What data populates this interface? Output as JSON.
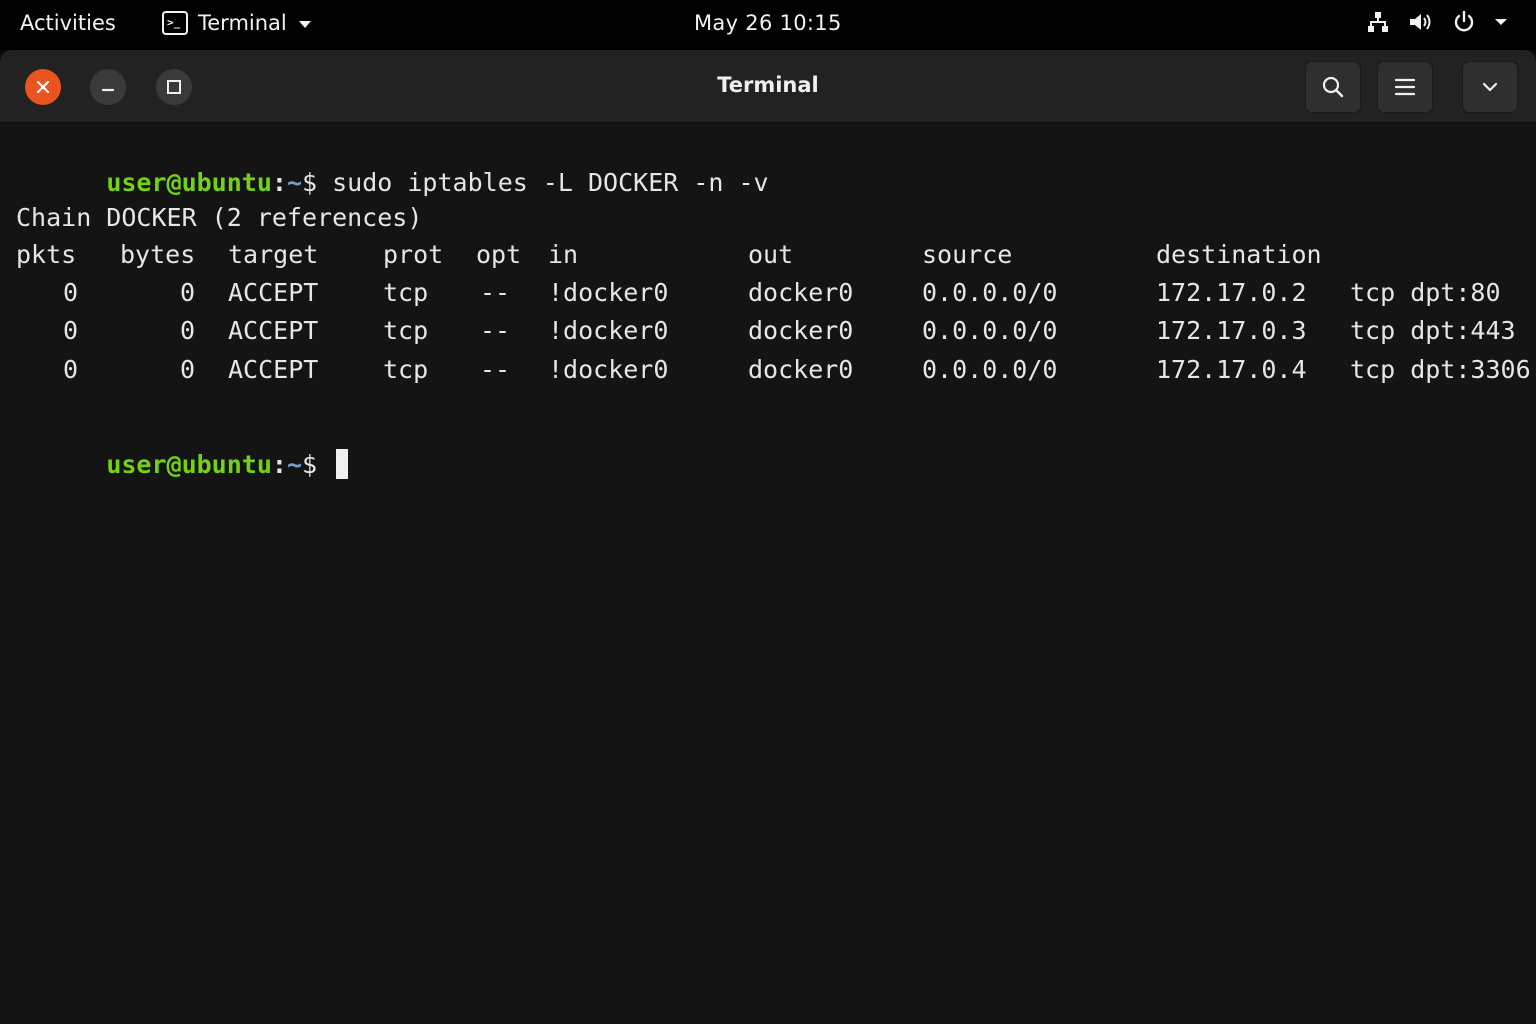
{
  "topbar": {
    "activities": "Activities",
    "app_icon_glyph": ">_",
    "app_name": "Terminal",
    "clock": "May 26  10:15",
    "icons": [
      "network-icon",
      "volume-icon",
      "power-icon",
      "chevron-down-icon"
    ]
  },
  "window": {
    "title": "Terminal",
    "buttons": [
      "close-icon",
      "minimize-icon",
      "maximize-icon",
      "search-icon",
      "hamburger-menu-icon",
      "chevron-down-icon"
    ]
  },
  "prompt": {
    "user_host": "user@ubuntu",
    "colon": ":",
    "path": "~",
    "dollar": "$ "
  },
  "command": "sudo iptables -L DOCKER -n -v",
  "chain_header": "Chain DOCKER (2 references)",
  "table": {
    "columns": [
      "pkts",
      "bytes",
      "target",
      "prot",
      "opt",
      "in",
      "out",
      "source",
      "destination"
    ],
    "rows": [
      {
        "pkts": "0",
        "bytes": "0",
        "target": "ACCEPT",
        "prot": "tcp",
        "opt": "--",
        "in": "!docker0",
        "out": "docker0",
        "source": "0.0.0.0/0",
        "destination": "172.17.0.2",
        "extra": "tcp dpt:80"
      },
      {
        "pkts": "0",
        "bytes": "0",
        "target": "ACCEPT",
        "prot": "tcp",
        "opt": "--",
        "in": "!docker0",
        "out": "docker0",
        "source": "0.0.0.0/0",
        "destination": "172.17.0.3",
        "extra": "tcp dpt:443"
      },
      {
        "pkts": "0",
        "bytes": "0",
        "target": "ACCEPT",
        "prot": "tcp",
        "opt": "--",
        "in": "!docker0",
        "out": "docker0",
        "source": "0.0.0.0/0",
        "destination": "172.17.0.4",
        "extra": "tcp dpt:3306"
      }
    ]
  },
  "colors": {
    "prompt_user": "#73d216",
    "prompt_path": "#729fcf",
    "close_button": "#e95420",
    "terminal_bg": "#141414"
  }
}
